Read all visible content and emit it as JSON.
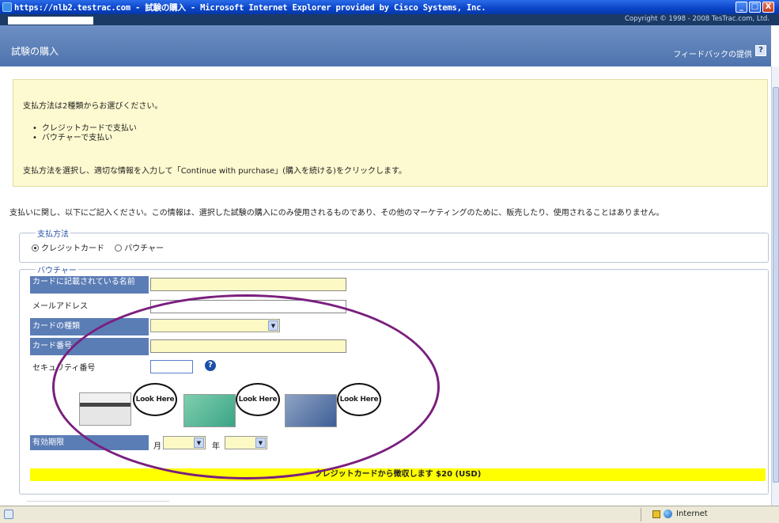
{
  "window": {
    "title": "https://nlb2.testrac.com - 試験の購入 - Microsoft Internet Explorer provided by Cisco Systems, Inc.",
    "buttons": {
      "minimize": "_",
      "maximize": "□",
      "close": "X"
    }
  },
  "copyright": "Copyright © 1998 - 2008 TesTrac.com, Ltd.",
  "header": {
    "title": "試験の購入",
    "feedback_label": "フィードバックの提供",
    "help_label": "?"
  },
  "info": {
    "line1": "支払方法は2種類からお選びください。",
    "options": [
      "クレジットカードで支払い",
      "バウチャーで支払い"
    ],
    "line2": "支払方法を選択し、適切な情報を入力して「Continue with purchase」(購入を続ける)をクリックします。"
  },
  "notice": "支払いに関し、以下にご記入ください。この情報は、選択した試験の購入にのみ使用されるものであり、その他のマーケティングのために、販売したり、使用されることはありません。",
  "payment_method": {
    "legend": "支払方法",
    "credit_card_label": "クレジットカード",
    "voucher_label": "バウチャー",
    "selected": "credit_card"
  },
  "voucher_section": {
    "legend": "バウチャー",
    "fields": {
      "name_label": "カードに記載されている名前",
      "email_label": "メールアドレス",
      "card_type_label": "カードの種類",
      "card_number_label": "カード番号",
      "security_label": "セキュリティ番号",
      "expiry_label": "有効期限"
    },
    "look_here": "Look Here",
    "month_label": "月",
    "year_label": "年"
  },
  "charge_text": "クレジットカードから徴収します $20 (USD)",
  "statusbar": {
    "zone": "Internet"
  },
  "colors": {
    "annotation_ellipse": "#7a1f7e",
    "charge_bar": "#ffff00",
    "info_background": "#fdf9d0"
  }
}
